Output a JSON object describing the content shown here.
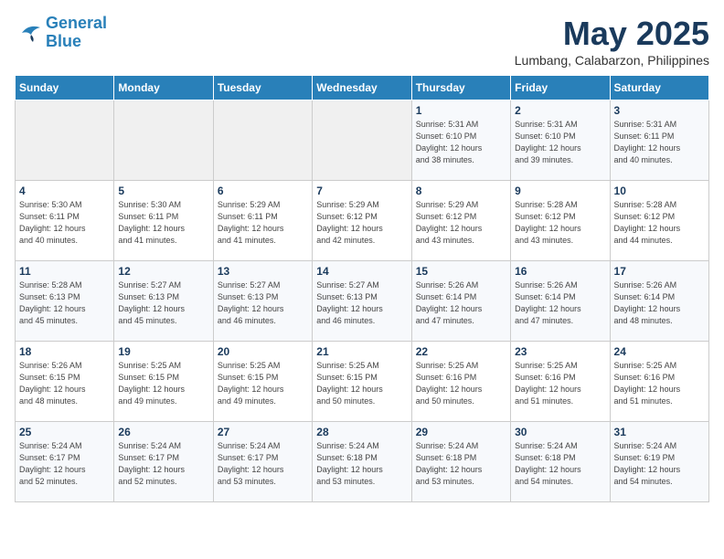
{
  "logo": {
    "line1": "General",
    "line2": "Blue"
  },
  "title": "May 2025",
  "subtitle": "Lumbang, Calabarzon, Philippines",
  "days_of_week": [
    "Sunday",
    "Monday",
    "Tuesday",
    "Wednesday",
    "Thursday",
    "Friday",
    "Saturday"
  ],
  "weeks": [
    [
      {
        "day": "",
        "info": ""
      },
      {
        "day": "",
        "info": ""
      },
      {
        "day": "",
        "info": ""
      },
      {
        "day": "",
        "info": ""
      },
      {
        "day": "1",
        "info": "Sunrise: 5:31 AM\nSunset: 6:10 PM\nDaylight: 12 hours\nand 38 minutes."
      },
      {
        "day": "2",
        "info": "Sunrise: 5:31 AM\nSunset: 6:10 PM\nDaylight: 12 hours\nand 39 minutes."
      },
      {
        "day": "3",
        "info": "Sunrise: 5:31 AM\nSunset: 6:11 PM\nDaylight: 12 hours\nand 40 minutes."
      }
    ],
    [
      {
        "day": "4",
        "info": "Sunrise: 5:30 AM\nSunset: 6:11 PM\nDaylight: 12 hours\nand 40 minutes."
      },
      {
        "day": "5",
        "info": "Sunrise: 5:30 AM\nSunset: 6:11 PM\nDaylight: 12 hours\nand 41 minutes."
      },
      {
        "day": "6",
        "info": "Sunrise: 5:29 AM\nSunset: 6:11 PM\nDaylight: 12 hours\nand 41 minutes."
      },
      {
        "day": "7",
        "info": "Sunrise: 5:29 AM\nSunset: 6:12 PM\nDaylight: 12 hours\nand 42 minutes."
      },
      {
        "day": "8",
        "info": "Sunrise: 5:29 AM\nSunset: 6:12 PM\nDaylight: 12 hours\nand 43 minutes."
      },
      {
        "day": "9",
        "info": "Sunrise: 5:28 AM\nSunset: 6:12 PM\nDaylight: 12 hours\nand 43 minutes."
      },
      {
        "day": "10",
        "info": "Sunrise: 5:28 AM\nSunset: 6:12 PM\nDaylight: 12 hours\nand 44 minutes."
      }
    ],
    [
      {
        "day": "11",
        "info": "Sunrise: 5:28 AM\nSunset: 6:13 PM\nDaylight: 12 hours\nand 45 minutes."
      },
      {
        "day": "12",
        "info": "Sunrise: 5:27 AM\nSunset: 6:13 PM\nDaylight: 12 hours\nand 45 minutes."
      },
      {
        "day": "13",
        "info": "Sunrise: 5:27 AM\nSunset: 6:13 PM\nDaylight: 12 hours\nand 46 minutes."
      },
      {
        "day": "14",
        "info": "Sunrise: 5:27 AM\nSunset: 6:13 PM\nDaylight: 12 hours\nand 46 minutes."
      },
      {
        "day": "15",
        "info": "Sunrise: 5:26 AM\nSunset: 6:14 PM\nDaylight: 12 hours\nand 47 minutes."
      },
      {
        "day": "16",
        "info": "Sunrise: 5:26 AM\nSunset: 6:14 PM\nDaylight: 12 hours\nand 47 minutes."
      },
      {
        "day": "17",
        "info": "Sunrise: 5:26 AM\nSunset: 6:14 PM\nDaylight: 12 hours\nand 48 minutes."
      }
    ],
    [
      {
        "day": "18",
        "info": "Sunrise: 5:26 AM\nSunset: 6:15 PM\nDaylight: 12 hours\nand 48 minutes."
      },
      {
        "day": "19",
        "info": "Sunrise: 5:25 AM\nSunset: 6:15 PM\nDaylight: 12 hours\nand 49 minutes."
      },
      {
        "day": "20",
        "info": "Sunrise: 5:25 AM\nSunset: 6:15 PM\nDaylight: 12 hours\nand 49 minutes."
      },
      {
        "day": "21",
        "info": "Sunrise: 5:25 AM\nSunset: 6:15 PM\nDaylight: 12 hours\nand 50 minutes."
      },
      {
        "day": "22",
        "info": "Sunrise: 5:25 AM\nSunset: 6:16 PM\nDaylight: 12 hours\nand 50 minutes."
      },
      {
        "day": "23",
        "info": "Sunrise: 5:25 AM\nSunset: 6:16 PM\nDaylight: 12 hours\nand 51 minutes."
      },
      {
        "day": "24",
        "info": "Sunrise: 5:25 AM\nSunset: 6:16 PM\nDaylight: 12 hours\nand 51 minutes."
      }
    ],
    [
      {
        "day": "25",
        "info": "Sunrise: 5:24 AM\nSunset: 6:17 PM\nDaylight: 12 hours\nand 52 minutes."
      },
      {
        "day": "26",
        "info": "Sunrise: 5:24 AM\nSunset: 6:17 PM\nDaylight: 12 hours\nand 52 minutes."
      },
      {
        "day": "27",
        "info": "Sunrise: 5:24 AM\nSunset: 6:17 PM\nDaylight: 12 hours\nand 53 minutes."
      },
      {
        "day": "28",
        "info": "Sunrise: 5:24 AM\nSunset: 6:18 PM\nDaylight: 12 hours\nand 53 minutes."
      },
      {
        "day": "29",
        "info": "Sunrise: 5:24 AM\nSunset: 6:18 PM\nDaylight: 12 hours\nand 53 minutes."
      },
      {
        "day": "30",
        "info": "Sunrise: 5:24 AM\nSunset: 6:18 PM\nDaylight: 12 hours\nand 54 minutes."
      },
      {
        "day": "31",
        "info": "Sunrise: 5:24 AM\nSunset: 6:19 PM\nDaylight: 12 hours\nand 54 minutes."
      }
    ]
  ]
}
